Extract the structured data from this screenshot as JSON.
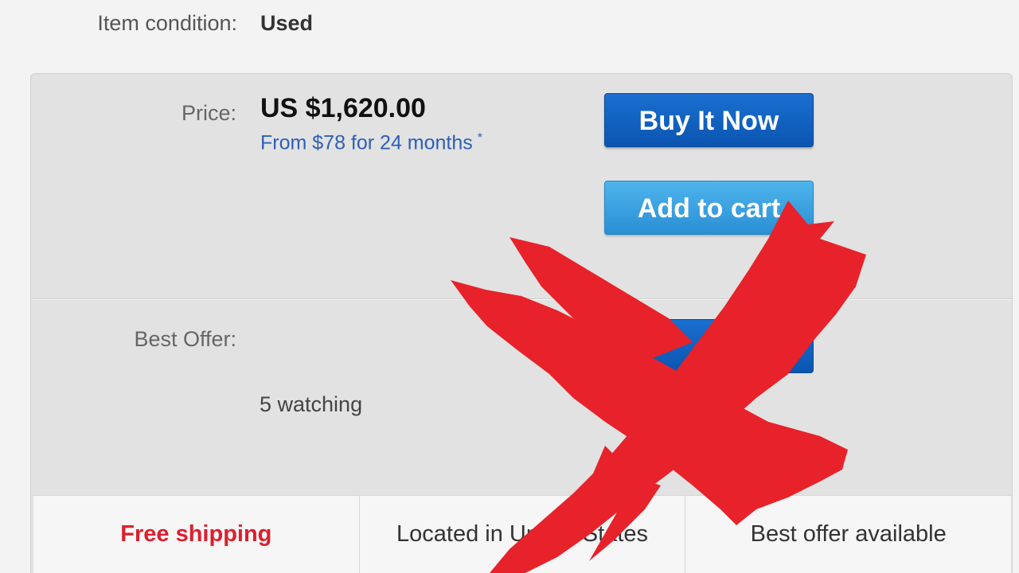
{
  "item": {
    "condition_label": "Item condition:",
    "condition_value": "Used"
  },
  "pricing": {
    "price_label": "Price:",
    "price_value": "US $1,620.00",
    "financing_text": "From $78 for 24 months",
    "financing_note": "*"
  },
  "actions": {
    "buy_now_label": "Buy It Now",
    "add_to_cart_label": "Add to cart"
  },
  "offer": {
    "best_offer_label": "Best Offer:",
    "watching_text": "5 watching"
  },
  "features": [
    {
      "label": "Free shipping"
    },
    {
      "label": "Located in United States"
    },
    {
      "label": "Best offer available"
    }
  ],
  "colors": {
    "primary_button": "#0b55b1",
    "secondary_button": "#3aa3e0",
    "link": "#2e5fb5",
    "free_shipping": "#dd1e2f",
    "overlay_cross": "#e8222a"
  },
  "overlay": {
    "icon": "red-x-cross-icon"
  }
}
